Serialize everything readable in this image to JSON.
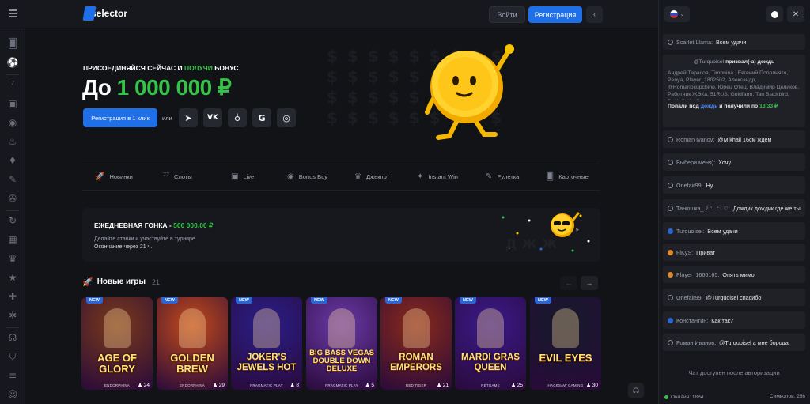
{
  "header": {
    "logo": "selector",
    "login_label": "Войти",
    "register_label": "Регистрация"
  },
  "hero": {
    "subtitle_part1": "ПРИСОЕДИНЯЙСЯ СЕЙЧАС И ",
    "subtitle_highlight": "ПОЛУЧИ",
    "subtitle_part2": " БОНУС",
    "title_prefix": "До ",
    "title_amount": "1 000 000 ₽",
    "cta_label": "Регистрация в 1 клик",
    "or_label": "или",
    "socials": [
      "telegram-icon",
      "vk-icon",
      "odnoklassniki-icon",
      "google-icon",
      "steam-icon"
    ]
  },
  "categories": [
    {
      "label": "Новинки",
      "icon": "rocket-icon"
    },
    {
      "label": "Слоты",
      "icon": "slots-icon"
    },
    {
      "label": "Live",
      "icon": "live-icon"
    },
    {
      "label": "Bonus Buy",
      "icon": "bonus-buy-icon"
    },
    {
      "label": "Джекпот",
      "icon": "jackpot-icon"
    },
    {
      "label": "Instant Win",
      "icon": "instant-win-icon"
    },
    {
      "label": "Рулетка",
      "icon": "roulette-icon"
    },
    {
      "label": "Карточные",
      "icon": "cards-icon"
    }
  ],
  "race": {
    "title": "ЕЖЕДНЕВНАЯ ГОНКА - ",
    "amount": "500 000.00 ₽",
    "desc": "Делайте ставки и участвуйте в турнире.",
    "ends": "Окончание через 21 ч."
  },
  "new_games": {
    "title": "Новые игры",
    "count": "21",
    "new_badge": "NEW",
    "games": [
      {
        "title": "AGE OF GLORY",
        "provider": "ENDORPHINA",
        "players": "24",
        "bg": "#7a3a1a"
      },
      {
        "title": "GOLDEN BREW",
        "provider": "ENDORPHINA",
        "players": "29",
        "bg": "#c24a1a"
      },
      {
        "title": "JOKER'S JEWELS HOT",
        "provider": "PRAGMATIC PLAY",
        "players": "8",
        "bg": "#2a1f8a"
      },
      {
        "title": "BIG BASS VEGAS DOUBLE DOWN DELUXE",
        "provider": "PRAGMATIC PLAY",
        "players": "5",
        "bg": "#6a3aa8"
      },
      {
        "title": "ROMAN EMPERORS",
        "provider": "RED TIGER",
        "players": "21",
        "bg": "#8a2a1a"
      },
      {
        "title": "MARDI GRAS QUEEN",
        "provider": "NETGAME",
        "players": "25",
        "bg": "#3a1a8a"
      },
      {
        "title": "EVIL EYES",
        "provider": "HACKSAW GAMING",
        "players": "30",
        "bg": "#141a2a"
      }
    ]
  },
  "chat": {
    "messages": [
      {
        "name": "Scarlet Llama:",
        "text": "Всем удачи",
        "avatar": "outline"
      },
      {
        "name": "Roman Ivanov:",
        "text": "@Mikhail 16см  ждём",
        "avatar": "outline"
      },
      {
        "name": "Выбери меня):",
        "text": "Хочу",
        "avatar": "outline"
      },
      {
        "name": "Onefair99:",
        "text": "Ну",
        "avatar": "outline"
      },
      {
        "name": "Танюшка_.꒰ᐢ. .ᐢ꒱♡:",
        "text": "Дождик дождик где же ты",
        "avatar": "outline"
      },
      {
        "name": "Turquoisel:",
        "text": "Всем удачи",
        "avatar": "blue"
      },
      {
        "name": "FlKyS:",
        "text": "Приват",
        "avatar": "orange"
      },
      {
        "name": "Player_1666165:",
        "text": "Опять мимо",
        "avatar": "orange"
      },
      {
        "name": "Onefair99:",
        "text": "@Turquoisel  спасибо",
        "avatar": "outline"
      },
      {
        "name": "Константин:",
        "text": "Как так?",
        "avatar": "blue"
      },
      {
        "name": "Роман Иванов:",
        "text": "@Turquoisel  а мне борода",
        "avatar": "outline"
      }
    ],
    "rain": {
      "user": "@Turquoisel",
      "action": "призвал(-а) дождь",
      "names": "Андрей Тарасов, Timonina , Евгений Пополнято, Penya, Player_1802502, Александр, @Romariocupchino, Юрец Отец, Владимир Целиков, Работник ЖЭКа, 51RUS, Goldfarm, Tan Blackbird, ВаНиЛьКа, Витанын",
      "caught_prefix": "Попали под",
      "rain_word": "дождь",
      "caught_mid": "и получили по",
      "amount": "13.33 ₽"
    },
    "auth_notice": "Чат доступен после авторизации",
    "online_label": "Онлайн: 1884",
    "symbols_label": "Символов: 256"
  },
  "colors": {
    "accent": "#1e6fe8",
    "green": "#35c34a",
    "bg": "#121317",
    "panel": "#1f2127"
  }
}
